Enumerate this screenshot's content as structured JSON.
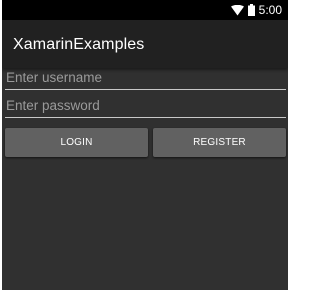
{
  "status_bar": {
    "time": "5:00",
    "icons": [
      "wifi-icon",
      "battery-icon"
    ]
  },
  "app": {
    "title": "XamarinExamples"
  },
  "form": {
    "username_placeholder": "Enter username",
    "username_value": "",
    "password_placeholder": "Enter password",
    "password_value": "",
    "login_label": "LOGIN",
    "register_label": "REGISTER"
  },
  "colors": {
    "background": "#303030",
    "action_bar": "#212121",
    "status_bar": "#000000",
    "button": "#616161"
  }
}
